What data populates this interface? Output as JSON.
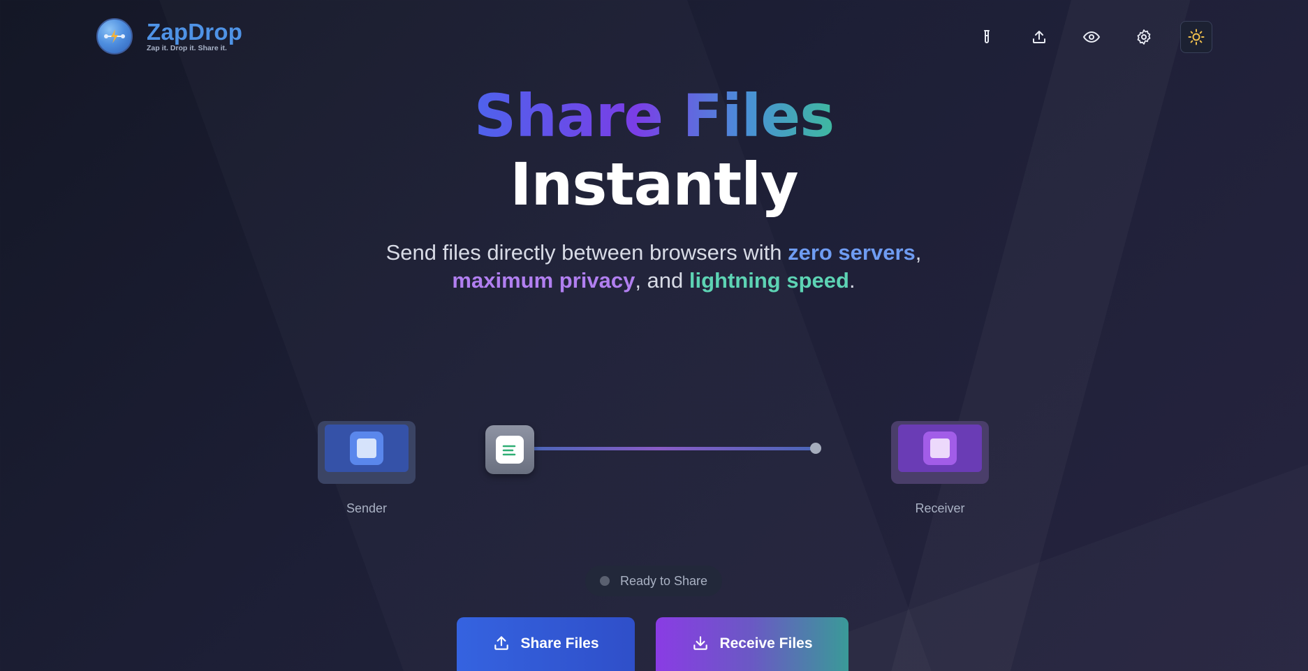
{
  "brand": {
    "name": "ZapDrop",
    "tagline": "Zap it. Drop it. Share it."
  },
  "nav": {
    "items": [
      {
        "name": "test-tube-icon"
      },
      {
        "name": "upload-icon"
      },
      {
        "name": "eye-icon"
      },
      {
        "name": "gear-icon"
      },
      {
        "name": "sun-icon",
        "active": true
      }
    ]
  },
  "hero": {
    "line1": "Share Files",
    "line2": "Instantly",
    "subtitle": {
      "part1": "Send files directly between browsers with ",
      "hl1": "zero servers",
      "part2": ",",
      "hl2": "maximum privacy",
      "part3": ", and ",
      "hl3": "lightning speed",
      "part4": "."
    }
  },
  "transfer": {
    "sender_label": "Sender",
    "receiver_label": "Receiver"
  },
  "status": {
    "text": "Ready to Share"
  },
  "actions": {
    "share_label": "Share Files",
    "receive_label": "Receive Files"
  },
  "colors": {
    "accent_blue": "#3563e0",
    "accent_purple": "#8a3ce4",
    "accent_teal": "#3fb8a0",
    "sun_icon": "#f2c14e"
  }
}
